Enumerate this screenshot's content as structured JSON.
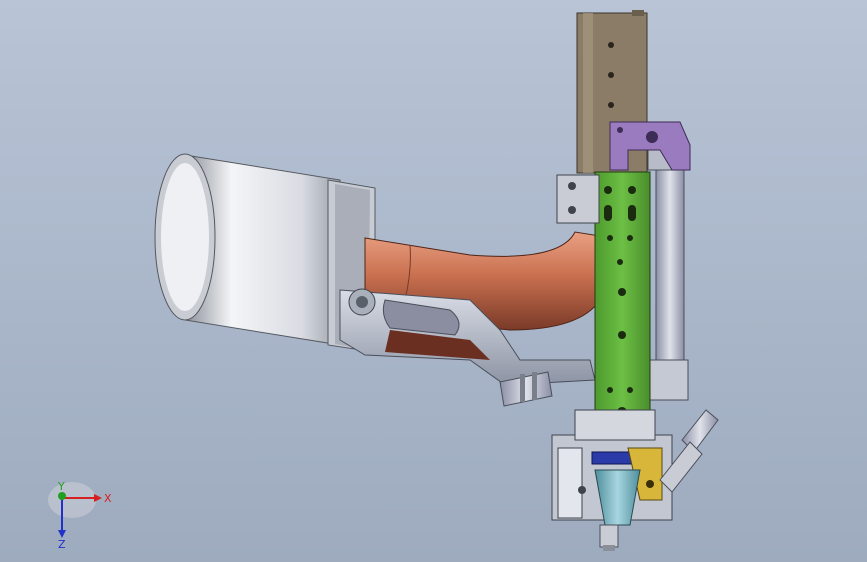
{
  "viewport": {
    "background_top": "#b9c4d6",
    "background_bottom": "#9eabbf"
  },
  "triad": {
    "x_label": "X",
    "y_label": "Y",
    "z_label": "Z",
    "x_color": "#d62020",
    "y_color": "#20a020",
    "z_color": "#2030c8"
  },
  "model": {
    "icons": [
      "welding-gun-model"
    ],
    "colors": {
      "canister": "#e6e8ec",
      "handle": "#c8704f",
      "plate": "#5fa83a",
      "bracket": "#8a7c66",
      "clamp": "#9b7bbf",
      "nozzle": "#7fb8c4",
      "brass": "#d8b63a",
      "ring": "#2a3aa8"
    }
  }
}
